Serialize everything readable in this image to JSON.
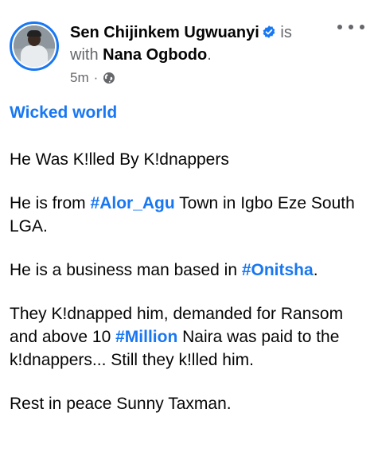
{
  "post": {
    "author": "Sen Chijinkem Ugwuanyi",
    "connector_is": "is",
    "connector_with": "with",
    "tagged": "Nana Ogbodo",
    "period": ".",
    "time": "5m",
    "separator": "·",
    "privacy_icon": "globe-icon",
    "verified_icon": "verified-badge-icon",
    "more_icon": "more-options-icon"
  },
  "body": {
    "title": "Wicked world",
    "line1": "He Was K!lled By K!dnappers",
    "p2": {
      "pre": "He is from ",
      "tag": "#Alor_Agu",
      "post": " Town in Igbo Eze South LGA."
    },
    "p3": {
      "pre": "He is a business man based in ",
      "tag": "#Onitsha",
      "post": "."
    },
    "p4": {
      "pre": "They K!dnapped him, demanded for Ransom  and above 10 ",
      "tag": "#Million",
      "post": " Naira was paid to the    k!dnappers... Still they k!lled him."
    },
    "closing": "Rest in peace Sunny Taxman."
  },
  "colors": {
    "accent": "#1877f2",
    "text": "#050505",
    "muted": "#65676b"
  }
}
